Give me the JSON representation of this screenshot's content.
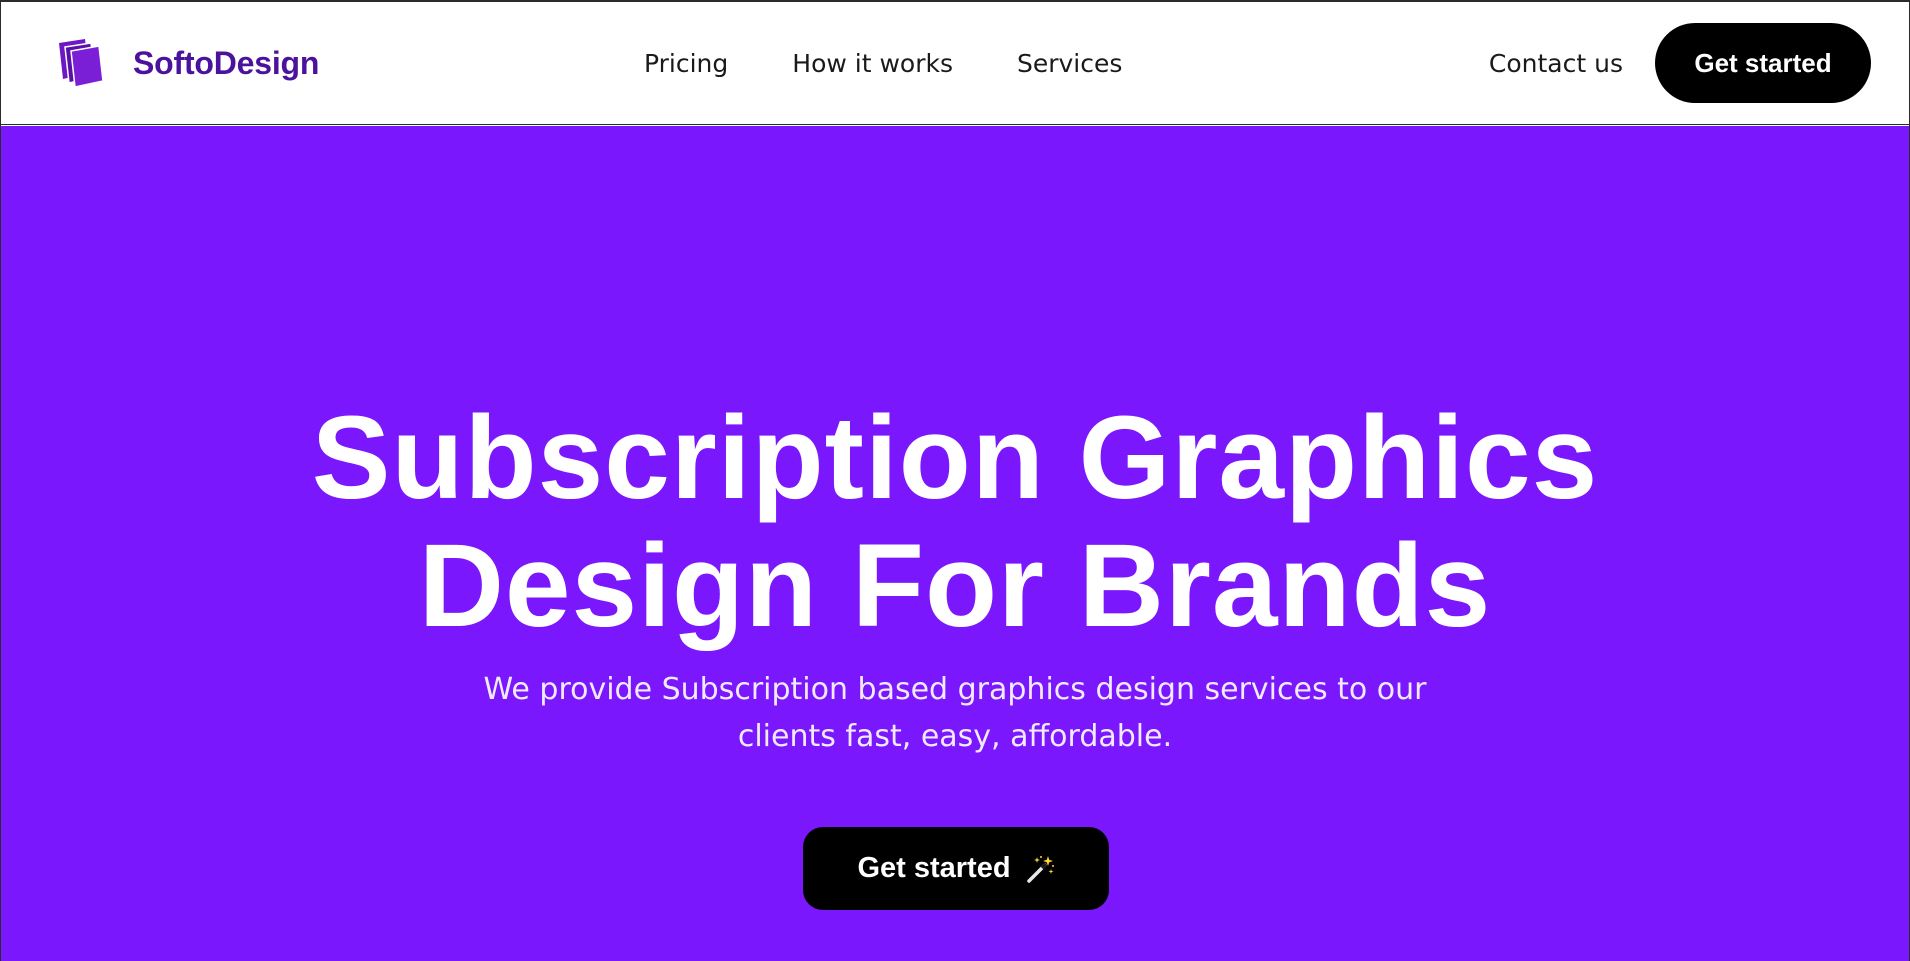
{
  "header": {
    "brand_name": "SoftoDesign",
    "nav": [
      {
        "label": "Pricing"
      },
      {
        "label": "How it works"
      },
      {
        "label": "Services"
      }
    ],
    "contact_label": "Contact us",
    "cta_label": "Get started"
  },
  "hero": {
    "title_line1": "Subscription Graphics",
    "title_line2": "Design For Brands",
    "subtitle_line1": "We provide Subscription based graphics design services to our",
    "subtitle_line2": "clients fast, easy, affordable.",
    "cta_label": "Get started",
    "cta_icon": "magic-wand-icon"
  },
  "colors": {
    "hero_background": "#7b17fc",
    "brand_text": "#4b129e",
    "button_background": "#000000",
    "button_text": "#ffffff"
  }
}
